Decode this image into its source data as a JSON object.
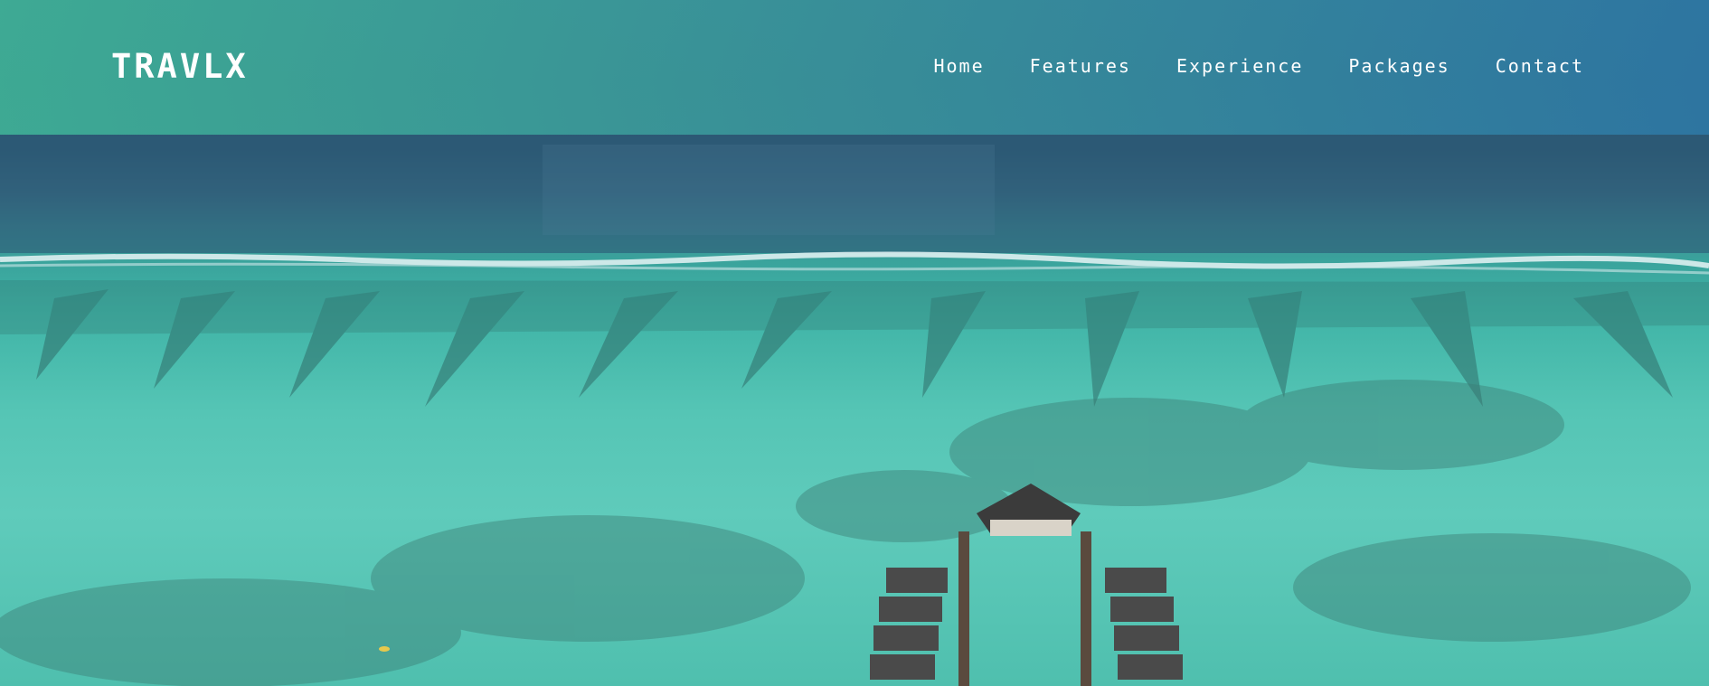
{
  "brand": {
    "name": "TRAVLX"
  },
  "nav": {
    "items": [
      {
        "label": "Home"
      },
      {
        "label": "Features"
      },
      {
        "label": "Experience"
      },
      {
        "label": "Packages"
      },
      {
        "label": "Contact"
      }
    ]
  },
  "hero": {
    "image": "aerial-overwater-villas-lagoon"
  },
  "colors": {
    "navbar_start": "#3fb096",
    "navbar_end": "#2e78a5",
    "ocean_deep": "#2a5470",
    "lagoon": "#55c5b5",
    "text": "#ffffff"
  }
}
